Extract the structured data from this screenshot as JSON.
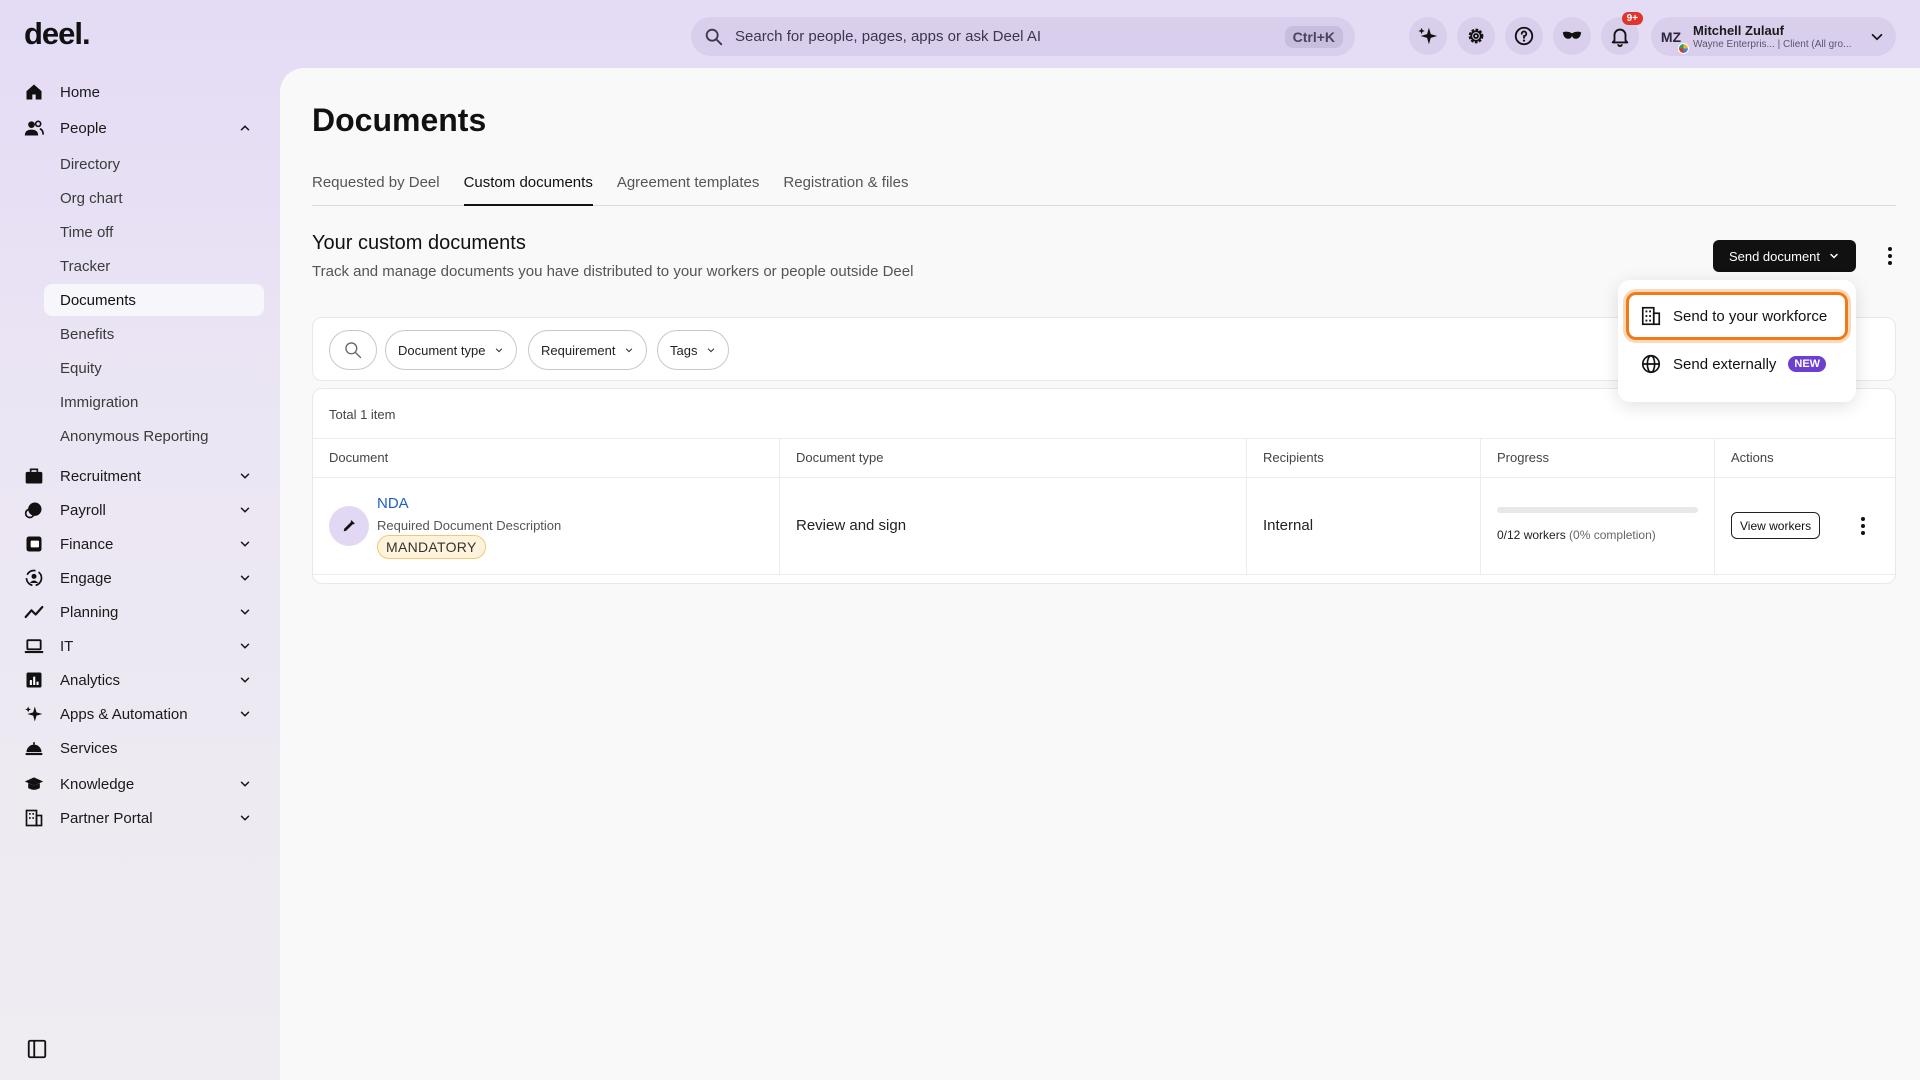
{
  "app": {
    "logo": "deel."
  },
  "search": {
    "placeholder": "Search for people, pages, apps or ask Deel AI",
    "shortcut": "Ctrl+K"
  },
  "topbar": {
    "icons": [
      "sparkle-icon",
      "gear-icon",
      "help-icon",
      "mask-icon",
      "bell-icon"
    ],
    "notifications_badge": "9+"
  },
  "profile": {
    "initials": "MZ",
    "name": "Mitchell Zulauf",
    "org": "Wayne Enterpris... | Client (All gro..."
  },
  "sidebar": {
    "items": [
      {
        "label": "Home",
        "icon": "home-icon"
      },
      {
        "label": "People",
        "icon": "people-icon",
        "expanded": true
      },
      {
        "label": "Recruitment",
        "icon": "briefcase-icon"
      },
      {
        "label": "Payroll",
        "icon": "payroll-icon"
      },
      {
        "label": "Finance",
        "icon": "finance-icon"
      },
      {
        "label": "Engage",
        "icon": "engage-icon"
      },
      {
        "label": "Planning",
        "icon": "trend-icon"
      },
      {
        "label": "IT",
        "icon": "laptop-icon"
      },
      {
        "label": "Analytics",
        "icon": "analytics-icon"
      },
      {
        "label": "Apps & Automation",
        "icon": "sparkle-icon"
      },
      {
        "label": "Services",
        "icon": "services-icon"
      },
      {
        "label": "Knowledge",
        "icon": "graduation-icon"
      },
      {
        "label": "Partner Portal",
        "icon": "building-icon"
      }
    ],
    "people_subitems": [
      "Directory",
      "Org chart",
      "Time off",
      "Tracker",
      "Documents",
      "Benefits",
      "Equity",
      "Immigration",
      "Anonymous Reporting"
    ],
    "active_subitem": "Documents"
  },
  "page": {
    "title": "Documents",
    "tabs": [
      "Requested by Deel",
      "Custom documents",
      "Agreement templates",
      "Registration & files"
    ],
    "active_tab": "Custom documents",
    "section_title": "Your custom documents",
    "section_subtitle": "Track and manage documents you have distributed to your workers or people outside Deel",
    "send_button": "Send document"
  },
  "filters": [
    "Document type",
    "Requirement",
    "Tags"
  ],
  "table": {
    "total": "Total 1 item",
    "columns": [
      "Document",
      "Document type",
      "Recipients",
      "Progress",
      "Actions"
    ],
    "rows": [
      {
        "name": "NDA",
        "description": "Required Document Description",
        "badge": "MANDATORY",
        "type": "Review and sign",
        "recipients": "Internal",
        "progress_fraction": 0,
        "progress_count": "0/12 workers",
        "progress_pct": "(0% completion)",
        "action": "View workers"
      }
    ]
  },
  "dropdown": {
    "items": [
      {
        "label": "Send to your workforce",
        "icon": "building-icon"
      },
      {
        "label": "Send externally",
        "icon": "globe-icon",
        "badge": "NEW"
      }
    ]
  },
  "colors": {
    "accent": "#f07a1a",
    "brand_purple": "#6d3fd1",
    "link": "#1f5fbf"
  }
}
